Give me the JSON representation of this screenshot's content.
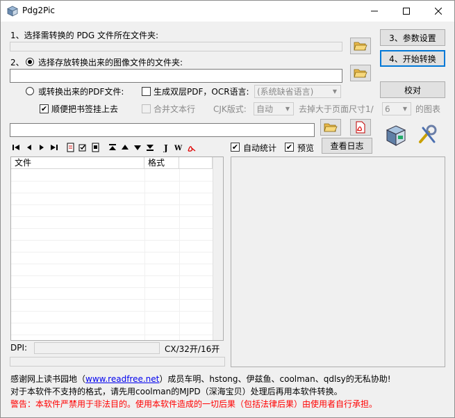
{
  "window": {
    "title": "Pdg2Pic",
    "minimize": "—",
    "maximize": "☐",
    "close": "✕"
  },
  "step1": {
    "label": "1、选择需转换的 PDG 文件所在文件夹:",
    "path": ""
  },
  "step2": {
    "label": "2、选择存放转换出来的图像文件的文件夹:",
    "path": ""
  },
  "pdf_option": {
    "label": "或转换出来的PDF文件:",
    "double_layer_label": "生成双层PDF，OCR语言:",
    "ocr_language": "(系统缺省语言)"
  },
  "bookmark": {
    "label": "顺便把书签挂上去",
    "checked": "✔"
  },
  "merge_text": {
    "label": "合并文本行"
  },
  "cjk": {
    "label": "CJK版式:",
    "value": "自动"
  },
  "remove_large": {
    "label": "去掉大于页面尺寸1/",
    "value": "6",
    "suffix": "的图表"
  },
  "buttons": {
    "params": "3、参数设置",
    "start": "4、开始转换",
    "proofread": "校对",
    "view_log": "查看日志"
  },
  "options": {
    "auto_stats": "自动统计",
    "preview": "预览",
    "checked": "✔"
  },
  "grid": {
    "columns": [
      "文件",
      "格式"
    ]
  },
  "status": {
    "dpi_label": "DPI:",
    "size_label": "CX/32开/16开"
  },
  "footer": {
    "thanks_prefix": "感谢网上读书园地（",
    "thanks_link": "www.readfree.net",
    "thanks_suffix": "）成员车明、hstong、伊兹鱼、coolman、qdlsy的无私协助!",
    "unsupported": "对于本软件不支持的格式，请先用coolman的MJPD（深海宝贝）处理后再用本软件转换。",
    "warning": "警告：本软件严禁用于非法目的。使用本软件造成的一切后果（包括法律后果）由使用者自行承担。"
  },
  "toolbar_icons": [
    "first-icon",
    "prev-icon",
    "next-icon",
    "last-icon",
    "doc-icon",
    "check-icon",
    "doc2-icon",
    "top-icon",
    "up-icon",
    "down-icon",
    "bottom-icon",
    "j-icon",
    "w-icon",
    "pdf-icon"
  ],
  "colors": {
    "link": "#0000ee",
    "warning": "#ff0000",
    "accent": "#0078d7"
  }
}
